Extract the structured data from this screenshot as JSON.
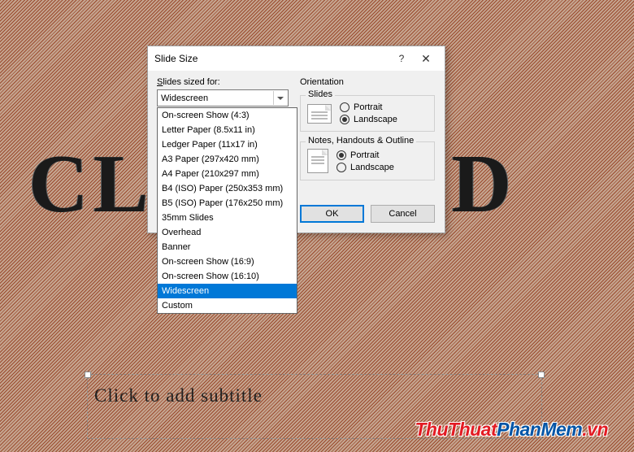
{
  "slide": {
    "title_text": "CL    TO  ADD",
    "subtitle_placeholder": "Click to add subtitle"
  },
  "watermark": {
    "part1": "ThuThuat",
    "part2": "PhanMem",
    "part3": ".vn"
  },
  "dialog": {
    "title": "Slide Size",
    "help_icon": "?",
    "close_icon": "✕",
    "sized_for_label": "Slides sized for:",
    "combo_value": "Widescreen",
    "options": [
      "On-screen Show (4:3)",
      "Letter Paper (8.5x11 in)",
      "Ledger Paper (11x17 in)",
      "A3 Paper (297x420 mm)",
      "A4 Paper (210x297 mm)",
      "B4 (ISO) Paper (250x353 mm)",
      "B5 (ISO) Paper (176x250 mm)",
      "35mm Slides",
      "Overhead",
      "Banner",
      "On-screen Show (16:9)",
      "On-screen Show (16:10)",
      "Widescreen",
      "Custom"
    ],
    "selected_index": 12,
    "orientation_label": "Orientation",
    "slides_group": "Slides",
    "notes_group": "Notes, Handouts & Outline",
    "portrait_label": "Portrait",
    "landscape_label": "Landscape",
    "slides_orientation": "Landscape",
    "notes_orientation": "Portrait",
    "ok_label": "OK",
    "cancel_label": "Cancel"
  }
}
